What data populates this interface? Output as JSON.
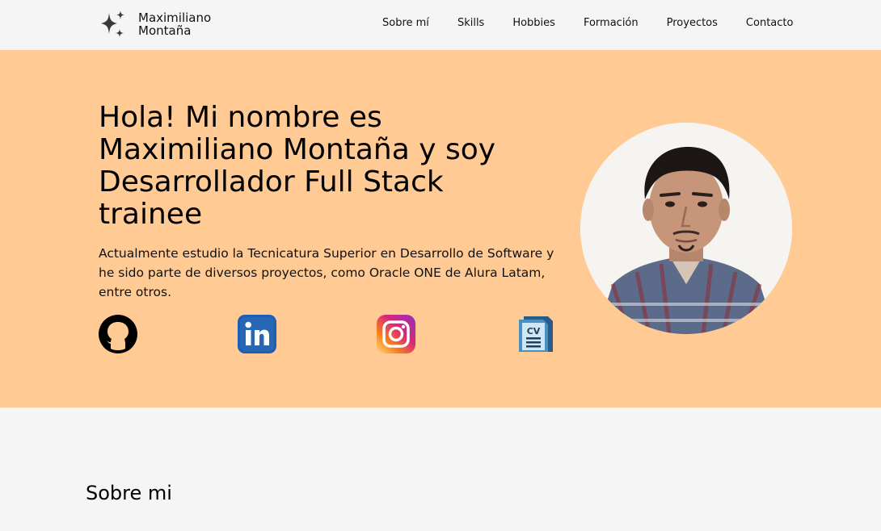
{
  "header": {
    "name_line1": "Maximiliano",
    "name_line2": "Montaña",
    "nav": [
      "Sobre mí",
      "Skills",
      "Hobbies",
      "Formación",
      "Proyectos",
      "Contacto"
    ]
  },
  "hero": {
    "title": "Hola! Mi nombre es Maximiliano Montaña y soy Desarrollador Full Stack trainee",
    "description": "Actualmente estudio la Tecnicatura Superior en Desarrollo de Software y he sido parte de diversos proyectos, como Oracle ONE de Alura Latam, entre otros.",
    "socials": [
      "github-icon",
      "linkedin-icon",
      "instagram-icon",
      "cv-icon"
    ],
    "cv_label": "CV"
  },
  "about": {
    "title": "Sobre mi"
  },
  "colors": {
    "hero_bg": "#ffca94",
    "page_bg": "#f5f5f5"
  }
}
